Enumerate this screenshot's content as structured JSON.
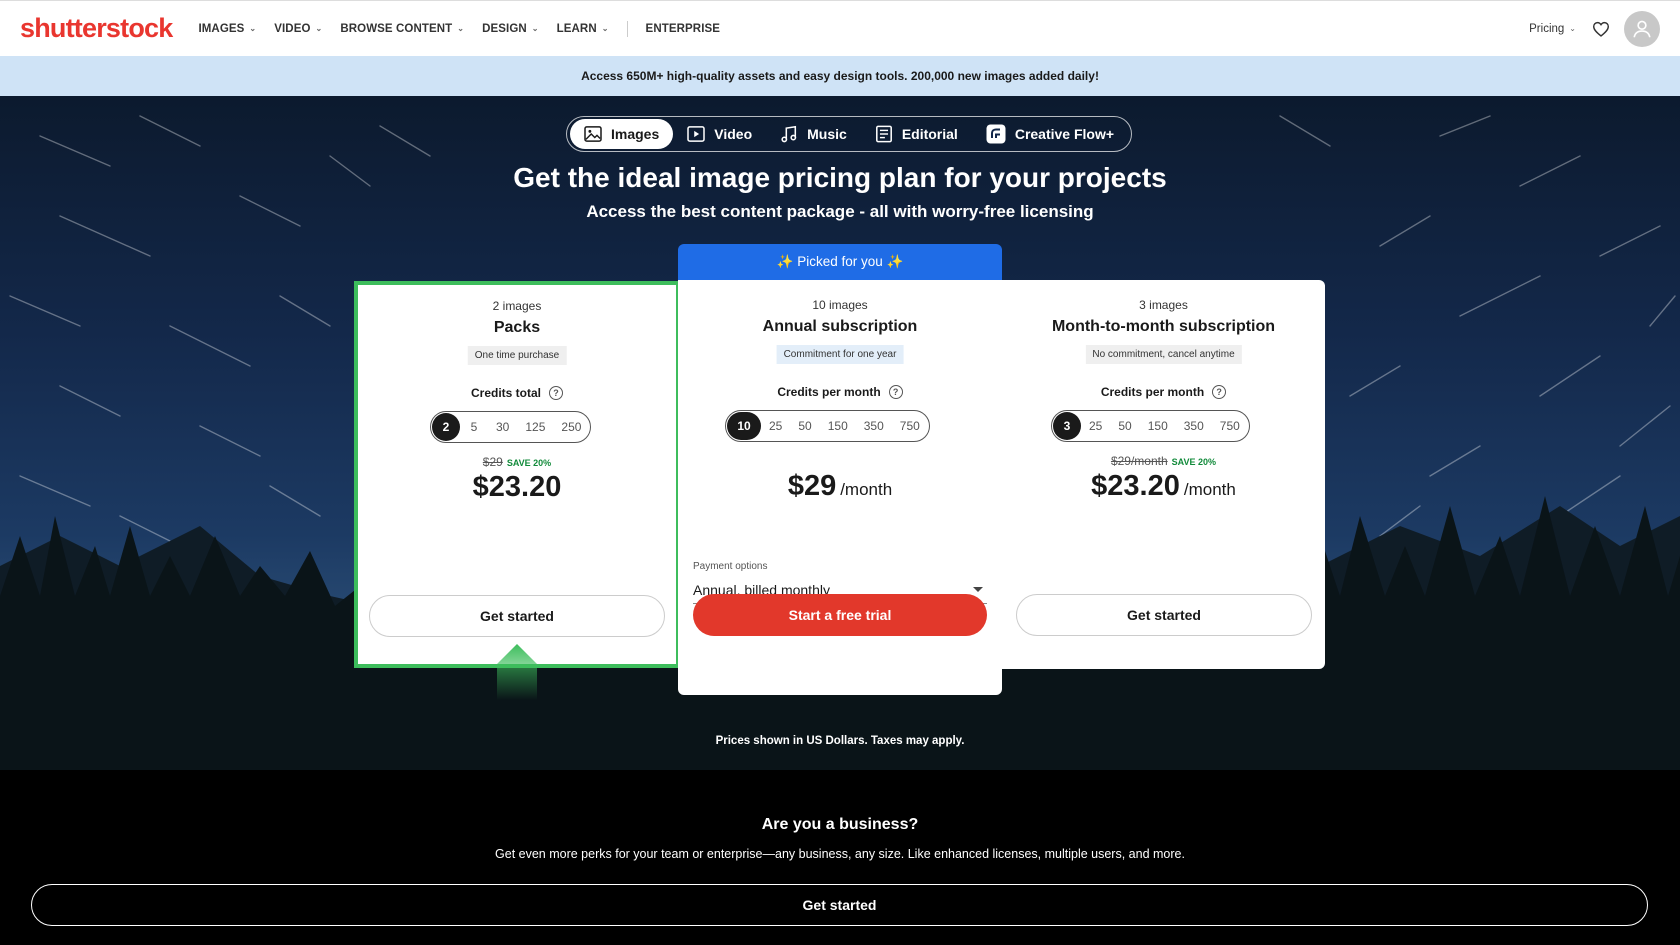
{
  "colors": {
    "brand": "#e9362f",
    "accent_blue": "#1f6ce6",
    "highlight_green": "#3dbd5c",
    "banner_bg": "#cfe3f6",
    "cta_red": "#e2382b"
  },
  "nav": {
    "logo": "shutterstock",
    "items": [
      {
        "label": "IMAGES",
        "has_chevron": true
      },
      {
        "label": "VIDEO",
        "has_chevron": true
      },
      {
        "label": "BROWSE CONTENT",
        "has_chevron": true
      },
      {
        "label": "DESIGN",
        "has_chevron": true
      },
      {
        "label": "LEARN",
        "has_chevron": true
      }
    ],
    "enterprise": "ENTERPRISE",
    "pricing": "Pricing",
    "icons": [
      "heart-icon",
      "user-avatar-icon",
      "chevron-down-icon"
    ]
  },
  "banner": {
    "text": "Access 650M+ high-quality assets and easy design tools. 200,000 new images added daily!"
  },
  "hero": {
    "tabs": [
      {
        "label": "Images",
        "icon": "image-icon",
        "active": true
      },
      {
        "label": "Video",
        "icon": "video-icon",
        "active": false
      },
      {
        "label": "Music",
        "icon": "music-note-icon",
        "active": false
      },
      {
        "label": "Editorial",
        "icon": "newspaper-icon",
        "active": false
      },
      {
        "label": "Creative Flow+",
        "icon": "creative-flow-icon",
        "active": false
      }
    ],
    "title": "Get the ideal image pricing plan for your projects",
    "subtitle": "Access the best content package - all with worry-free licensing",
    "picked_label": "✨ Picked for you ✨"
  },
  "plans": {
    "packs": {
      "count": "2 images",
      "name": "Packs",
      "badge": "One time purchase",
      "credits_label": "Credits total",
      "options": [
        "2",
        "5",
        "30",
        "125",
        "250"
      ],
      "selected": "2",
      "old_price": "$29",
      "save": "SAVE 20%",
      "price": "$23.20",
      "button": "Get started"
    },
    "annual": {
      "count": "10 images",
      "name": "Annual subscription",
      "badge": "Commitment for one year",
      "credits_label": "Credits per month",
      "options": [
        "10",
        "25",
        "50",
        "150",
        "350",
        "750"
      ],
      "selected": "10",
      "price": "$29",
      "per": "/month",
      "payment_label": "Payment options",
      "payment_value": "Annual, billed monthly",
      "button": "Start a free trial"
    },
    "monthly": {
      "count": "3 images",
      "name": "Month-to-month subscription",
      "badge": "No commitment, cancel anytime",
      "credits_label": "Credits per month",
      "options": [
        "3",
        "25",
        "50",
        "150",
        "350",
        "750"
      ],
      "selected": "3",
      "old_price": "$29/month",
      "save": "SAVE 20%",
      "price": "$23.20",
      "per": "/month",
      "button": "Get started"
    }
  },
  "disclaimer": "Prices shown in US Dollars. Taxes may apply.",
  "business": {
    "title": "Are you a business?",
    "subtitle": "Get even more perks for your team or enterprise—any business, any size. Like enhanced licenses, multiple users, and more.",
    "button": "Get started"
  }
}
